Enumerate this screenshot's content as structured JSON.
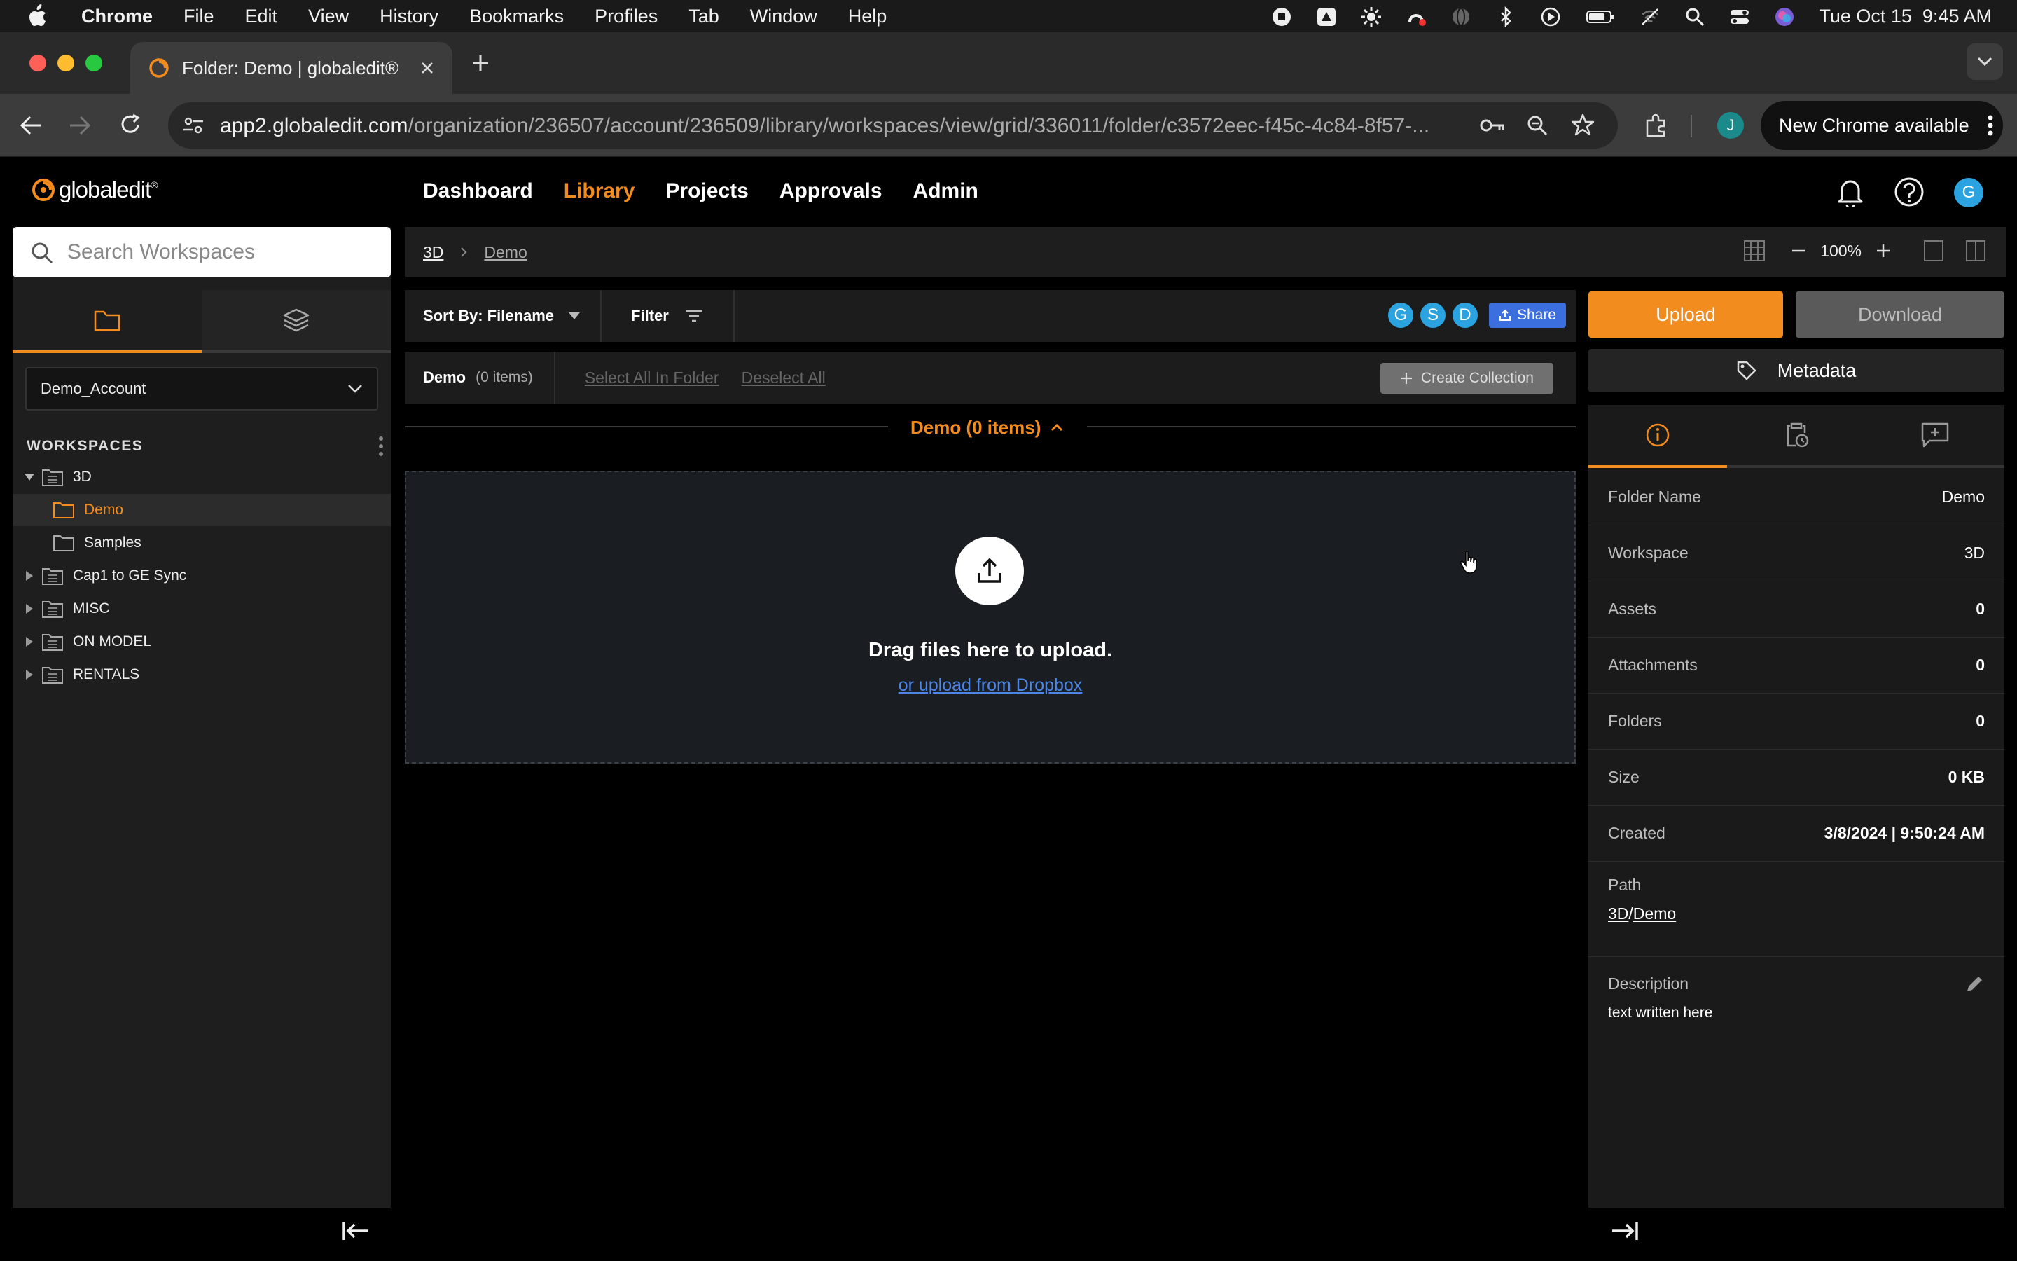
{
  "macos": {
    "menu": [
      "Chrome",
      "File",
      "Edit",
      "View",
      "History",
      "Bookmarks",
      "Profiles",
      "Tab",
      "Window",
      "Help"
    ],
    "clock": "Tue Oct 15  9:45 AM"
  },
  "browser": {
    "tab_title": "Folder: Demo | globaledit®",
    "url_host": "app2.globaledit.com",
    "url_path": "/organization/236507/account/236509/library/workspaces/view/grid/336011/folder/c3572eec-f45c-4c84-8f57-...",
    "profile_initial": "J",
    "update_label": "New Chrome available"
  },
  "app": {
    "brand": "globaledit",
    "nav": [
      "Dashboard",
      "Library",
      "Projects",
      "Approvals",
      "Admin"
    ],
    "active_nav": "Library",
    "user_initial": "G"
  },
  "sidebar": {
    "search_placeholder": "Search Workspaces",
    "account": "Demo_Account",
    "section_title": "WORKSPACES",
    "tree": [
      {
        "label": "3D",
        "expanded": true
      },
      {
        "label": "Demo",
        "child": true,
        "active": true
      },
      {
        "label": "Samples",
        "child": true
      },
      {
        "label": "Cap1 to GE Sync"
      },
      {
        "label": "MISC"
      },
      {
        "label": "ON MODEL"
      },
      {
        "label": "RENTALS"
      }
    ]
  },
  "main": {
    "breadcrumb": [
      "3D",
      "Demo"
    ],
    "zoom": "100%",
    "sort_label": "Sort By: Filename",
    "filter_label": "Filter",
    "share_avatars": [
      "G",
      "S",
      "D"
    ],
    "share_label": "Share",
    "folder_name": "Demo",
    "folder_count": "(0 items)",
    "select_all": "Select All In Folder",
    "deselect_all": "Deselect All",
    "create_collection": "Create Collection",
    "group_header": "Demo (0 items)",
    "drop_title": "Drag files here to upload.",
    "drop_link": "or upload from Dropbox"
  },
  "panel": {
    "upload": "Upload",
    "download": "Download",
    "metadata": "Metadata",
    "info": [
      {
        "key": "Folder Name",
        "value": "Demo"
      },
      {
        "key": "Workspace",
        "value": "3D"
      },
      {
        "key": "Assets",
        "value": "0"
      },
      {
        "key": "Attachments",
        "value": "0"
      },
      {
        "key": "Folders",
        "value": "0"
      },
      {
        "key": "Size",
        "value": "0 KB"
      },
      {
        "key": "Created",
        "value": "3/8/2024 | 9:50:24 AM"
      }
    ],
    "path_label": "Path",
    "path_parts": [
      "3D",
      "/",
      "Demo"
    ],
    "description_label": "Description",
    "description": "text written here"
  },
  "colors": {
    "accent": "#f28c1e",
    "avatar": "#2aa3e0",
    "share": "#3b6fe0",
    "link": "#4d86e6"
  }
}
